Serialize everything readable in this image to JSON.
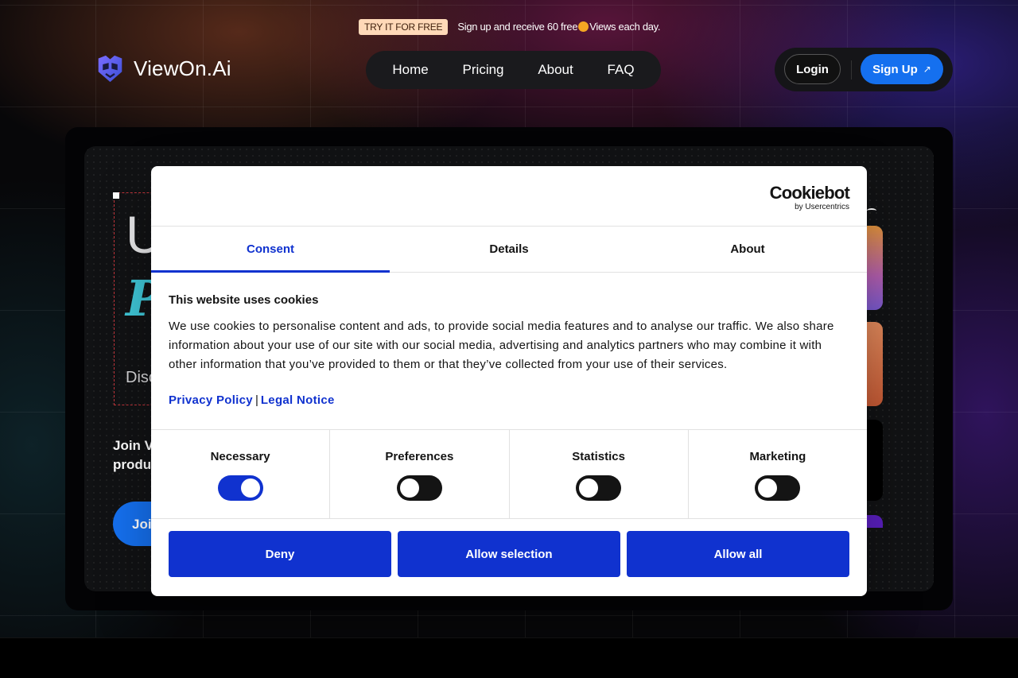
{
  "promo": {
    "badge": "TRY IT FOR FREE",
    "text_before": "Sign up and receive 60 free ",
    "text_after": "Views each day."
  },
  "header": {
    "brand": "ViewOn.Ai",
    "nav": [
      "Home",
      "Pricing",
      "About",
      "FAQ"
    ],
    "login": "Login",
    "signup": "Sign Up",
    "signup_icon": "arrow-up-right-icon"
  },
  "hero": {
    "headline_fragment_1": "U",
    "headline_fragment_2": "P",
    "subtitle_fragment": "Disc",
    "join_line_1": "Join Vi",
    "join_line_2": "produc",
    "cta_fragment": "Join"
  },
  "cookie_dialog": {
    "logo_main": "Cookiebot",
    "logo_sub": "by Usercentrics",
    "tabs": [
      "Consent",
      "Details",
      "About"
    ],
    "active_tab": "Consent",
    "title": "This website uses cookies",
    "body": "We use cookies to personalise content and ads, to provide social media features and to analyse our traffic. We also share information about your use of our site with our social media, advertising and analytics partners who may combine it with other information that you’ve provided to them or that they’ve collected from your use of their services.",
    "privacy_link": "Privacy Policy",
    "legal_link": "Legal Notice",
    "link_separator": "|",
    "categories": [
      {
        "label": "Necessary",
        "enabled": true
      },
      {
        "label": "Preferences",
        "enabled": false
      },
      {
        "label": "Statistics",
        "enabled": false
      },
      {
        "label": "Marketing",
        "enabled": false
      }
    ],
    "buttons": {
      "deny": "Deny",
      "allow_selection": "Allow selection",
      "allow_all": "Allow all"
    }
  },
  "colors": {
    "accent_blue": "#1032cf",
    "signup_blue": "#1570ef",
    "promo_badge": "#ffd9b8",
    "hero_teal": "#3fc7d8"
  }
}
